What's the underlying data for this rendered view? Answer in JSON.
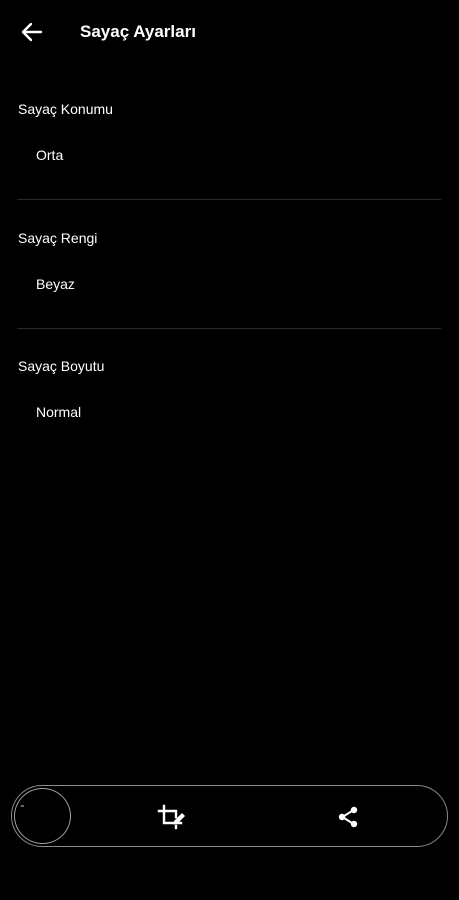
{
  "header": {
    "title": "Sayaç Ayarları",
    "back_icon": "arrow-left-icon"
  },
  "settings": [
    {
      "label": "Sayaç Konumu",
      "value": "Orta"
    },
    {
      "label": "Sayaç Rengi",
      "value": "Beyaz"
    },
    {
      "label": "Sayaç Boyutu",
      "value": "Normal"
    }
  ],
  "bottom_bar": {
    "record_icon": "record-circle-icon",
    "edit_icon": "crop-edit-icon",
    "share_icon": "share-icon"
  },
  "colors": {
    "background": "#000000",
    "text": "#ffffff",
    "divider": "#2a2a2a",
    "bar_border": "#8a8a8a"
  }
}
